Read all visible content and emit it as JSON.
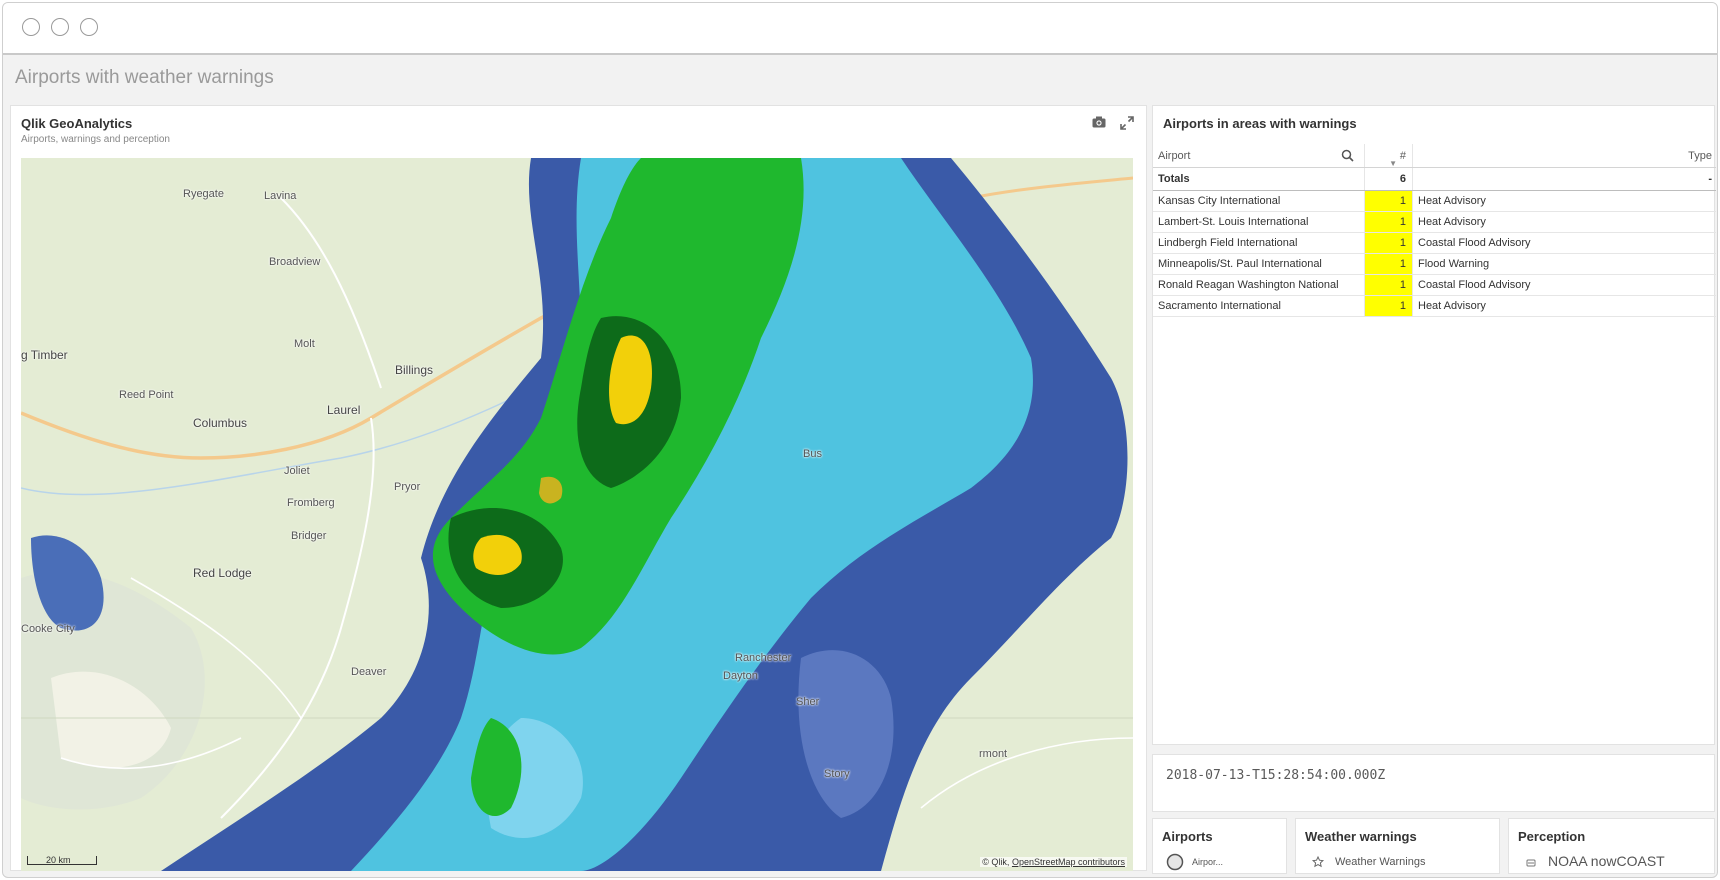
{
  "window": {
    "controls": [
      "close-dot",
      "minimize-dot",
      "maximize-dot"
    ]
  },
  "sheet": {
    "title": "Airports with weather warnings"
  },
  "map_panel": {
    "title": "Qlik GeoAnalytics",
    "subtitle": "Airports, warnings and perception",
    "icons": [
      "camera-icon",
      "expand-icon"
    ],
    "cities": {
      "ryegate": "Ryegate",
      "lavina": "Lavina",
      "broadview": "Broadview",
      "molt": "Molt",
      "big_timber": "g Timber",
      "billings": "Billings",
      "reed_point": "Reed Point",
      "laurel": "Laurel",
      "columbus": "Columbus",
      "joliet": "Joliet",
      "pryor": "Pryor",
      "fromberg": "Fromberg",
      "bridger": "Bridger",
      "red_lodge": "Red Lodge",
      "cooke_city": "Cooke City",
      "deaver": "Deaver",
      "ranchester": "Ranchester",
      "dayton": "Dayton",
      "sheridan": "Sher",
      "busby": "Bus",
      "story": "Story",
      "fairmont": "rmont"
    },
    "scale_label": "20 km",
    "attribution_prefix": "© Qlik, ",
    "attribution_link": "OpenStreetMap contributors",
    "colors": {
      "land": "#e4ecd4",
      "radar_low": "#3a5aa8",
      "radar_mid": "#4fc3e0",
      "radar_high": "#1fb82e",
      "radar_dark": "#0d6b1a",
      "radar_peak": "#f2d00a",
      "road_major": "#f4c98c"
    }
  },
  "table": {
    "title": "Airports in areas with warnings",
    "headers": {
      "airport": "Airport",
      "count": "#",
      "type": "Type"
    },
    "totals": {
      "label": "Totals",
      "count": "6",
      "type": "-"
    },
    "rows": [
      {
        "airport": "Kansas City International",
        "count": "1",
        "type": "Heat Advisory"
      },
      {
        "airport": "Lambert-St. Louis International",
        "count": "1",
        "type": "Heat Advisory"
      },
      {
        "airport": "Lindbergh Field International",
        "count": "1",
        "type": "Coastal Flood Advisory"
      },
      {
        "airport": "Minneapolis/St. Paul International",
        "count": "1",
        "type": "Flood Warning"
      },
      {
        "airport": "Ronald Reagan Washington National",
        "count": "1",
        "type": "Coastal Flood Advisory"
      },
      {
        "airport": "Sacramento International",
        "count": "1",
        "type": "Heat Advisory"
      }
    ],
    "highlight_color": "#ffff00"
  },
  "timestamp": {
    "value": "2018-07-13-T15:28:54:00.000Z"
  },
  "legends": {
    "airports": {
      "title": "Airports",
      "item": "Airpor..."
    },
    "warnings": {
      "title": "Weather warnings",
      "item": "Weather Warnings"
    },
    "perception": {
      "title": "Perception",
      "item": "NOAA nowCOAST"
    }
  }
}
